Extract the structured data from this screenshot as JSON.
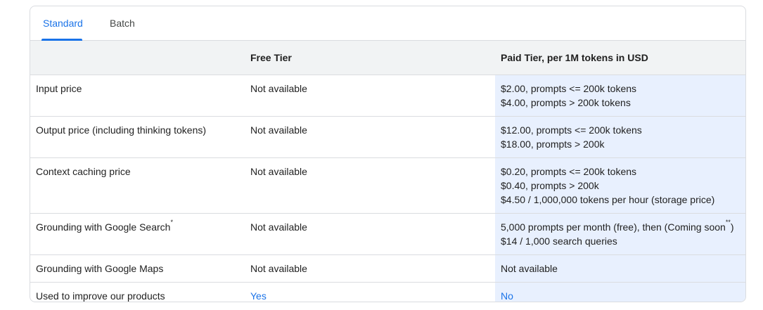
{
  "tabs": [
    {
      "label": "Standard",
      "active": true
    },
    {
      "label": "Batch",
      "active": false
    }
  ],
  "table": {
    "headers": [
      "",
      "Free Tier",
      "Paid Tier, per 1M tokens in USD"
    ],
    "rows": [
      {
        "label": "Input price",
        "free": "Not available",
        "paid": [
          "$2.00, prompts <= 200k tokens",
          "$4.00, prompts > 200k tokens"
        ]
      },
      {
        "label": "Output price (including thinking tokens)",
        "free": "Not available",
        "paid": [
          "$12.00, prompts <= 200k tokens",
          "$18.00, prompts > 200k"
        ]
      },
      {
        "label": "Context caching price",
        "free": "Not available",
        "paid": [
          "$0.20, prompts <= 200k tokens",
          "$0.40, prompts > 200k",
          "$4.50 / 1,000,000 tokens per hour (storage price)"
        ]
      },
      {
        "label": "Grounding with Google Search",
        "label_sup": "*",
        "free": "Not available",
        "paid_line1_prefix": "5,000 prompts per month (free), then (Coming soon",
        "paid_line1_sup": "**",
        "paid_line1_suffix": ")",
        "paid_line2": "$14 / 1,000 search queries"
      },
      {
        "label": "Grounding with Google Maps",
        "free": "Not available",
        "paid": [
          "Not available"
        ]
      },
      {
        "label": "Used to improve our products",
        "free": "Yes",
        "paid": [
          "No"
        ]
      }
    ]
  },
  "colors": {
    "accent": "#1a73e8",
    "paid_column_bg": "#e8f0fe",
    "header_bg": "#f1f3f4"
  }
}
